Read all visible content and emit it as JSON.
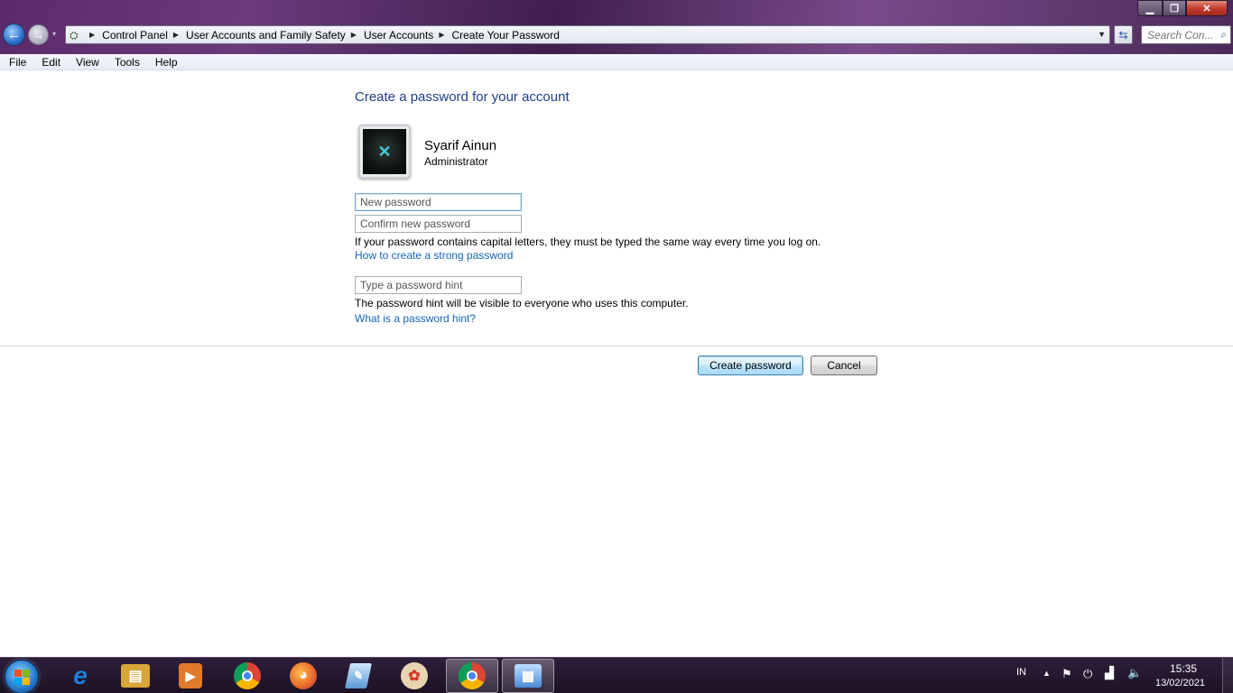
{
  "window": {
    "minimize_label": "▁",
    "maximize_label": "❐",
    "close_label": "✕"
  },
  "nav": {
    "back_glyph": "←",
    "forward_glyph": "→",
    "dropdown_glyph": "▾"
  },
  "address": {
    "breadcrumbs": [
      "Control Panel",
      "User Accounts and Family Safety",
      "User Accounts",
      "Create Your Password"
    ],
    "separator_glyph": "▶",
    "dropdown_glyph": "▼",
    "refresh_glyph": "⇆"
  },
  "search": {
    "placeholder": "Search Con...",
    "icon": "search-icon"
  },
  "menu": {
    "items": [
      "File",
      "Edit",
      "View",
      "Tools",
      "Help"
    ]
  },
  "page": {
    "title": "Create a password for your account",
    "user_name": "Syarif Ainun",
    "user_role": "Administrator",
    "new_password_placeholder": "New password",
    "confirm_password_placeholder": "Confirm new password",
    "caps_note": "If your password contains capital letters, they must be typed the same way every time you log on.",
    "strong_password_link": "How to create a strong password",
    "hint_placeholder": "Type a password hint",
    "hint_note": "The password hint will be visible to everyone who uses this computer.",
    "hint_link": "What is a password hint?",
    "create_button": "Create password",
    "cancel_button": "Cancel"
  },
  "taskbar": {
    "apps": [
      {
        "name": "internet-explorer",
        "glyph": "e",
        "color": "#1e7fd8"
      },
      {
        "name": "windows-explorer",
        "glyph": "▤",
        "color": "#d9a63a"
      },
      {
        "name": "media-player",
        "glyph": "▶",
        "color": "#e07a2a"
      },
      {
        "name": "chrome",
        "glyph": "◉",
        "color": "#3aa757"
      },
      {
        "name": "firefox",
        "glyph": "◕",
        "color": "#e8662a"
      },
      {
        "name": "notepad",
        "glyph": "✎",
        "color": "#5a9ad8"
      },
      {
        "name": "paint",
        "glyph": "✿",
        "color": "#c89a5a"
      },
      {
        "name": "chrome-active",
        "glyph": "◉",
        "color": "#3aa757"
      },
      {
        "name": "control-panel",
        "glyph": "▦",
        "color": "#4a8ad8"
      }
    ],
    "language": "IN",
    "time": "15:35",
    "date": "13/02/2021"
  },
  "colors": {
    "title_blue": "#1e3f8a",
    "link_blue": "#1565b8"
  }
}
